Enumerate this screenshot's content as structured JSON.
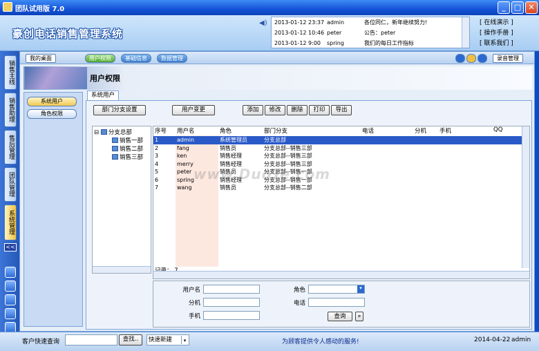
{
  "window": {
    "title": "团队试用版  7.0",
    "min": "_",
    "max": "□",
    "close": "✕"
  },
  "header": {
    "brand": "豪创电话销售管理系统",
    "notices": [
      {
        "time": "2013-01-12 23:37",
        "user": "admin",
        "msg": "各位同仁，新年继续努力!"
      },
      {
        "time": "2013-01-12 10:46",
        "user": "peter",
        "msg": "公告：peter"
      },
      {
        "time": "2013-01-12 9:00",
        "user": "spring",
        "msg": "我们的每日工作指标"
      }
    ],
    "links": [
      "[   在线演示   ]",
      "[   操作手册   ]",
      "[   联系我们   ]"
    ]
  },
  "leftnav": {
    "tabs": [
      "销售主线",
      "销售助理",
      "售后管理",
      "团队管理",
      "系统管理"
    ],
    "collapse": "<<"
  },
  "tabbar": {
    "mydesk": "我的桌面",
    "tabs": [
      "用户权限",
      "基础信息",
      "数据管理"
    ],
    "record_mgmt": "录音管理"
  },
  "banner": {
    "title": "用户权限"
  },
  "side": {
    "items": [
      "系统用户",
      "角色权限"
    ]
  },
  "content": {
    "tab": "系统用户",
    "buttons": {
      "dept": "部门分支设置",
      "change": "用户变更",
      "add": "添加",
      "edit": "修改",
      "delete": "删除",
      "print": "打印",
      "export": "导出"
    },
    "tree": {
      "root": "分支总部",
      "children": [
        "销售一部",
        "销售二部",
        "销售三部"
      ]
    },
    "columns": [
      "序号",
      "用户名",
      "角色",
      "部门分支",
      "电话",
      "分机",
      "手机",
      "QQ"
    ],
    "rows": [
      {
        "no": "1",
        "user": "admin",
        "role": "系统管理员",
        "dept": "分支总部"
      },
      {
        "no": "2",
        "user": "fang",
        "role": "销售员",
        "dept": "分支总部--销售三部"
      },
      {
        "no": "3",
        "user": "ken",
        "role": "销售经理",
        "dept": "分支总部--销售三部"
      },
      {
        "no": "4",
        "user": "merry",
        "role": "销售经理",
        "dept": "分支总部--销售三部"
      },
      {
        "no": "5",
        "user": "peter",
        "role": "销售员",
        "dept": "分支总部--销售一部"
      },
      {
        "no": "6",
        "user": "spring",
        "role": "销售经理",
        "dept": "分支总部--销售一部"
      },
      {
        "no": "7",
        "user": "wang",
        "role": "销售员",
        "dept": "分支总部--销售二部"
      }
    ],
    "record_label": "记录：",
    "record_count": "7",
    "form": {
      "username": "用户名",
      "role": "角色",
      "ext": "分机",
      "phone": "电话",
      "mobile": "手机",
      "query": "查询",
      "more": "»"
    }
  },
  "watermark": "www.DuoTe.com",
  "statusbar": {
    "quick_label": "客户快速查询",
    "search": "查找..",
    "new_select": "快速新建",
    "slogan": "为顾客提供令人感动的服务!",
    "date": "2014-04-22",
    "user": "admin"
  }
}
